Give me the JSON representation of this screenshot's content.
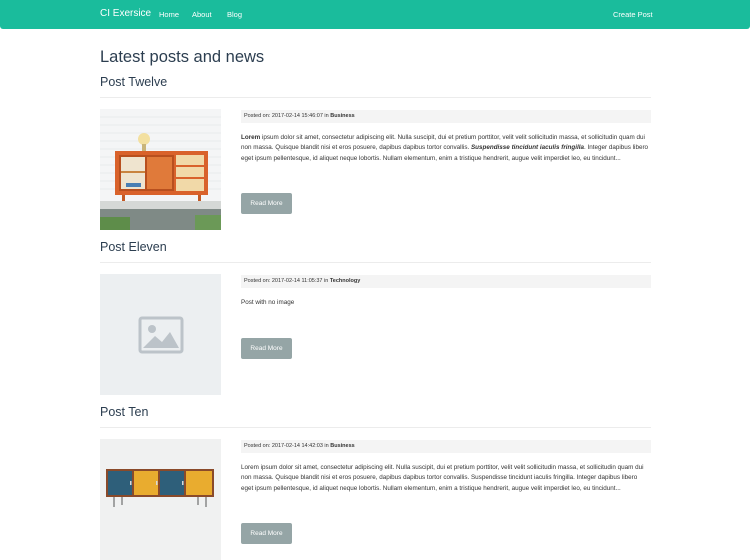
{
  "navbar": {
    "brand": "CI Exersice",
    "links": [
      "Home",
      "About",
      "Blog"
    ],
    "create": "Create Post"
  },
  "page": {
    "title": "Latest posts and news"
  },
  "posts": [
    {
      "title": "Post Twelve",
      "meta_prefix": "Posted on: 2017-02-14 15:46:07 in ",
      "category": "Business",
      "body_strong": "Lorem",
      "body_1": " ipsum dolor sit amet, consectetur adipiscing elit. Nulla suscipit, dui et pretium porttitor, velit velit sollicitudin massa, et sollicitudin quam dui non massa. Quisque blandit nisi et eros posuere, dapibus dapibus tortor convallis. ",
      "body_em": "Suspendisse tincidunt iaculis fringilla",
      "body_2": ". Integer dapibus libero eget ipsum pellentesque, id aliquet neque lobortis. Nullam elementum, enim a tristique hendrerit, augue velit imperdiet leo, eu tincidunt...",
      "read_more": "Read More",
      "image": "sideboard-icon"
    },
    {
      "title": "Post Eleven",
      "meta_prefix": "Posted on: 2017-02-14 11:05:37 in ",
      "category": "Technology",
      "body": "Post with no image",
      "read_more": "Read More",
      "image": "image-placeholder-icon"
    },
    {
      "title": "Post Ten",
      "meta_prefix": "Posted on: 2017-02-14 14:42:03 in ",
      "category": "Business",
      "body": "Lorem ipsum dolor sit amet, consectetur adipiscing elit. Nulla suscipit, dui et pretium porttitor, velit velit sollicitudin massa, et sollicitudin quam dui non massa. Quisque blandit nisi et eros posuere, dapibus dapibus tortor convallis. Suspendisse tincidunt iaculis fringilla. Integer dapibus libero eget ipsum pellentesque, id aliquet neque lobortis. Nullam elementum, enim a tristique hendrerit, augue velit imperdiet leo, eu tincidunt...",
      "read_more": "Read More",
      "image": "cabinet-icon"
    }
  ],
  "colors": {
    "navbar": "#1abc9c",
    "button": "#95a5a6",
    "text": "#2c3e50"
  }
}
